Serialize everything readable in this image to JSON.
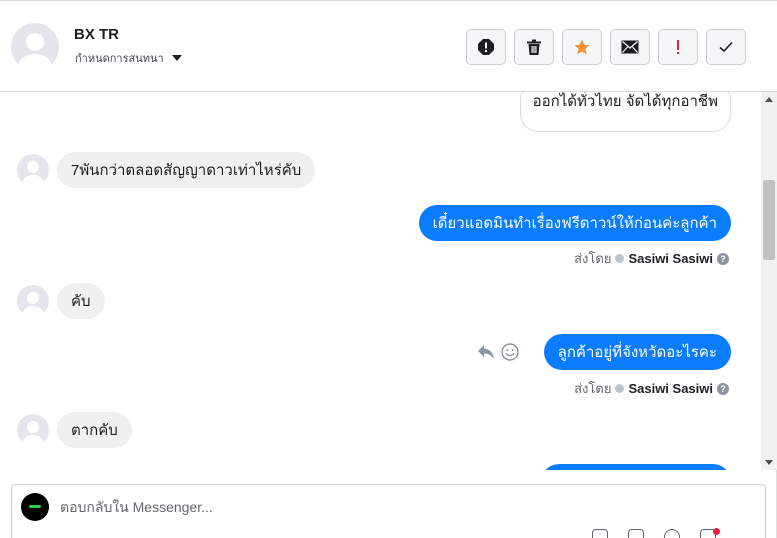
{
  "header": {
    "name": "BX TR",
    "subtitle": "กำหนดการสนทนา",
    "actions": [
      {
        "name": "spam-icon"
      },
      {
        "name": "trash-icon"
      },
      {
        "name": "star-icon"
      },
      {
        "name": "envelope-icon"
      },
      {
        "name": "exclamation-icon"
      },
      {
        "name": "checkmark-icon"
      }
    ],
    "star_color": "#f7923b",
    "exclamation_color": "#e41e3f"
  },
  "messages": {
    "m0_partial": "ออกได้ทั่วไทย จัดได้ทุกอาชีพ",
    "m1": "7พันกว่าตลอดสัญญาดาวเท่าไหร่คับ",
    "m2": "เดี๋ยวแอดมินทำเรื่องฟรีดาวน์ให้ก่อนค่ะลูกค้า",
    "m2_sent_prefix": "ส่งโดย",
    "m2_sent_by": "Sasiwi Sasiwi",
    "m3": "คับ",
    "m4": "ลูกค้าอยู่ที่จังหวัดอะไรคะ",
    "m4_sent_prefix": "ส่งโดย",
    "m4_sent_by": "Sasiwi Sasiwi",
    "m5": "ตากคับ",
    "help_glyph": "?"
  },
  "composer": {
    "placeholder": "ตอบกลับใน Messenger..."
  },
  "colors": {
    "outgoing_bubble": "#0a7cff",
    "incoming_bubble": "#f0f0f0"
  }
}
